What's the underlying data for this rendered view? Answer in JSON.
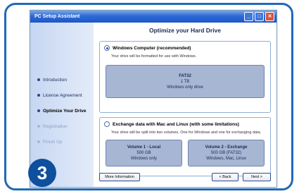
{
  "step": {
    "number": "3"
  },
  "window": {
    "title": "PC Setup Assistant",
    "controls": {
      "minimize": "_",
      "maximize": "□",
      "close": "✕"
    }
  },
  "sidebar": {
    "items": [
      {
        "label": "Introduction",
        "state": "done"
      },
      {
        "label": "License Agreement",
        "state": "done"
      },
      {
        "label": "Optimize Your Drive",
        "state": "current"
      },
      {
        "label": "Registration",
        "state": "pending"
      },
      {
        "label": "Finish Up",
        "state": "pending"
      }
    ]
  },
  "main": {
    "title": "Optimize your Hard Drive",
    "option1": {
      "label": "Windows Computer (recommended)",
      "selected": true,
      "description": "Your drive will be formatted for use with Windows.",
      "card": {
        "title": "FAT32",
        "size": "1 TB",
        "note": "Windows only drive"
      }
    },
    "option2": {
      "label": "Exchange data with Mac and Linux (with some limitations)",
      "selected": false,
      "description": "Your drive will be split into two volumes. One for Windows and one for exchanging data.",
      "card_a": {
        "title": "Volume 1 - Local",
        "size": "500 GB",
        "note": "Windows only"
      },
      "card_b": {
        "title": "Volume 2 - Exchange",
        "size": "500 GB (FAT32)",
        "note": "Windows, Mac, Linux"
      }
    }
  },
  "footer": {
    "more_info": "More Information",
    "back": "< Back",
    "next": "Next >"
  },
  "colors": {
    "frame": "#1f6ab8",
    "step_badge": "#0e4f9e",
    "titlebar": "#2d6ad7",
    "card": "#a6b6d3"
  }
}
